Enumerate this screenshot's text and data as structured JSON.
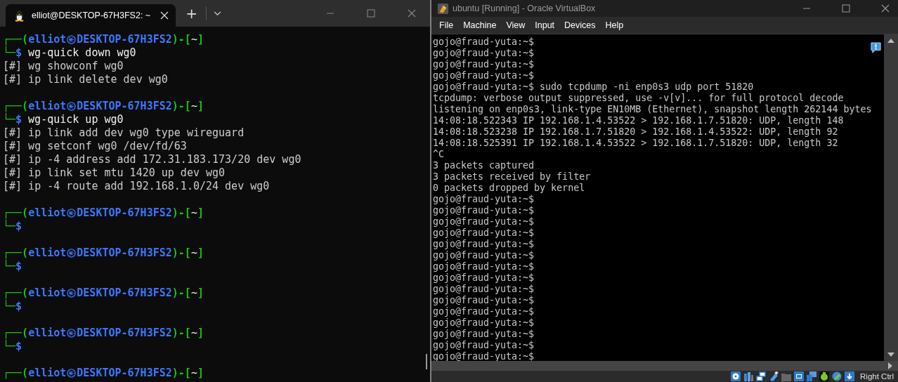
{
  "terminal": {
    "tab": {
      "title": "elliot@DESKTOP-67H3FS2: ~",
      "selected": true
    },
    "new_tab": "+",
    "lines": [
      {
        "kind": "prompt",
        "open": "┌──(",
        "user": "elliot",
        "host": "DESKTOP-67H3FS2",
        "sep": ")-[",
        "dir": "~",
        "close": "]",
        "corner": "└─",
        "sigil": "$",
        "command": "wg-quick down wg0"
      },
      {
        "kind": "output",
        "text": "[#] wg showconf wg0"
      },
      {
        "kind": "output",
        "text": "[#] ip link delete dev wg0"
      },
      {
        "kind": "blank"
      },
      {
        "kind": "prompt",
        "open": "┌──(",
        "user": "elliot",
        "host": "DESKTOP-67H3FS2",
        "sep": ")-[",
        "dir": "~",
        "close": "]",
        "corner": "└─",
        "sigil": "$",
        "command": "wg-quick up wg0"
      },
      {
        "kind": "output",
        "text": "[#] ip link add dev wg0 type wireguard"
      },
      {
        "kind": "output",
        "text": "[#] wg setconf wg0 /dev/fd/63"
      },
      {
        "kind": "output",
        "text": "[#] ip -4 address add 172.31.183.173/20 dev wg0"
      },
      {
        "kind": "output",
        "text": "[#] ip link set mtu 1420 up dev wg0"
      },
      {
        "kind": "output",
        "text": "[#] ip -4 route add 192.168.1.0/24 dev wg0"
      },
      {
        "kind": "blank"
      },
      {
        "kind": "prompt",
        "open": "┌──(",
        "user": "elliot",
        "host": "DESKTOP-67H3FS2",
        "sep": ")-[",
        "dir": "~",
        "close": "]",
        "corner": "└─",
        "sigil": "$"
      },
      {
        "kind": "blank"
      },
      {
        "kind": "prompt",
        "open": "┌──(",
        "user": "elliot",
        "host": "DESKTOP-67H3FS2",
        "sep": ")-[",
        "dir": "~",
        "close": "]",
        "corner": "└─",
        "sigil": "$"
      },
      {
        "kind": "blank"
      },
      {
        "kind": "prompt",
        "open": "┌──(",
        "user": "elliot",
        "host": "DESKTOP-67H3FS2",
        "sep": ")-[",
        "dir": "~",
        "close": "]",
        "corner": "└─",
        "sigil": "$"
      },
      {
        "kind": "blank"
      },
      {
        "kind": "prompt",
        "open": "┌──(",
        "user": "elliot",
        "host": "DESKTOP-67H3FS2",
        "sep": ")-[",
        "dir": "~",
        "close": "]",
        "corner": "└─",
        "sigil": "$"
      },
      {
        "kind": "blank"
      },
      {
        "kind": "prompt",
        "open": "┌──(",
        "user": "elliot",
        "host": "DESKTOP-67H3FS2",
        "sep": ")-[",
        "dir": "~",
        "close": "]"
      }
    ]
  },
  "virtualbox": {
    "title": "ubuntu [Running] - Oracle VirtualBox",
    "menu": [
      "File",
      "Machine",
      "View",
      "Input",
      "Devices",
      "Help"
    ],
    "console": [
      "gojo@fraud-yuta:~$",
      "gojo@fraud-yuta:~$",
      "gojo@fraud-yuta:~$",
      "gojo@fraud-yuta:~$",
      "gojo@fraud-yuta:~$ sudo tcpdump -ni enp0s3 udp port 51820",
      "tcpdump: verbose output suppressed, use -v[v]... for full protocol decode",
      "listening on enp0s3, link-type EN10MB (Ethernet), snapshot length 262144 bytes",
      "14:08:18.522343 IP 192.168.1.4.53522 > 192.168.1.7.51820: UDP, length 148",
      "14:08:18.523238 IP 192.168.1.7.51820 > 192.168.1.4.53522: UDP, length 92",
      "14:08:18.525391 IP 192.168.1.4.53522 > 192.168.1.7.51820: UDP, length 32",
      "^C",
      "3 packets captured",
      "3 packets received by filter",
      "0 packets dropped by kernel",
      "gojo@fraud-yuta:~$",
      "gojo@fraud-yuta:~$",
      "gojo@fraud-yuta:~$",
      "gojo@fraud-yuta:~$",
      "gojo@fraud-yuta:~$",
      "gojo@fraud-yuta:~$",
      "gojo@fraud-yuta:~$",
      "gojo@fraud-yuta:~$",
      "gojo@fraud-yuta:~$",
      "gojo@fraud-yuta:~$",
      "gojo@fraud-yuta:~$",
      "gojo@fraud-yuta:~$",
      "gojo@fraud-yuta:~$",
      "gojo@fraud-yuta:~$",
      "gojo@fraud-yuta:~$"
    ],
    "status_bar": {
      "host_key": "Right Ctrl"
    }
  }
}
